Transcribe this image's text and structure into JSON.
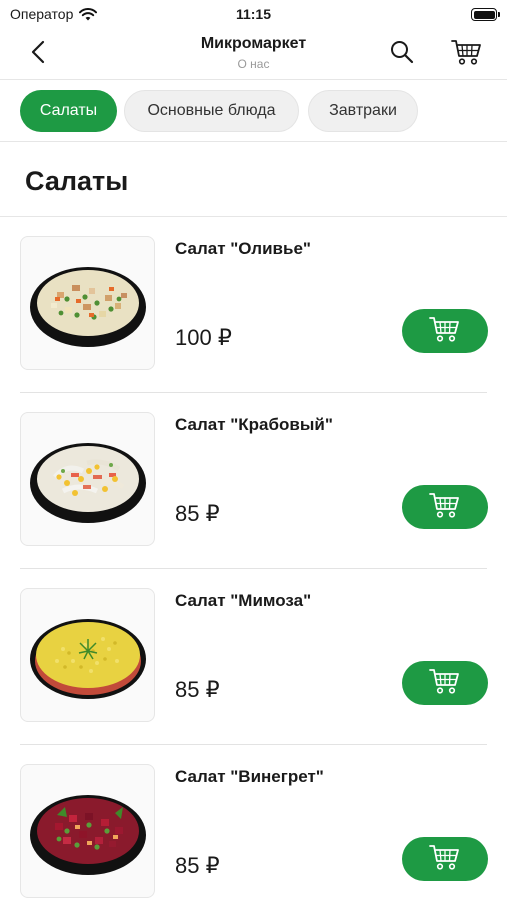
{
  "status_bar": {
    "carrier": "Оператор",
    "time": "11:15"
  },
  "nav": {
    "title": "Микромаркет",
    "subtitle": "О нас"
  },
  "categories": [
    {
      "label": "Салаты",
      "active": true
    },
    {
      "label": "Основные блюда",
      "active": false
    },
    {
      "label": "Завтраки",
      "active": false
    }
  ],
  "section": {
    "title": "Салаты"
  },
  "products": [
    {
      "name": "Салат \"Оливье\"",
      "price": "100 ₽",
      "image": "olivier-salad-image"
    },
    {
      "name": "Салат \"Крабовый\"",
      "price": "85 ₽",
      "image": "crab-salad-image"
    },
    {
      "name": "Салат \"Мимоза\"",
      "price": "85 ₽",
      "image": "mimosa-salad-image"
    },
    {
      "name": "Салат \"Винегрет\"",
      "price": "85 ₽",
      "image": "vinegret-salad-image"
    }
  ],
  "colors": {
    "accent": "#1e9a44",
    "chip_inactive": "#f0f0f0",
    "divider": "#e6e6e6"
  },
  "icons": {
    "back": "chevron-left-icon",
    "search": "search-icon",
    "cart": "cart-icon",
    "add_to_cart": "add-to-cart-icon"
  }
}
